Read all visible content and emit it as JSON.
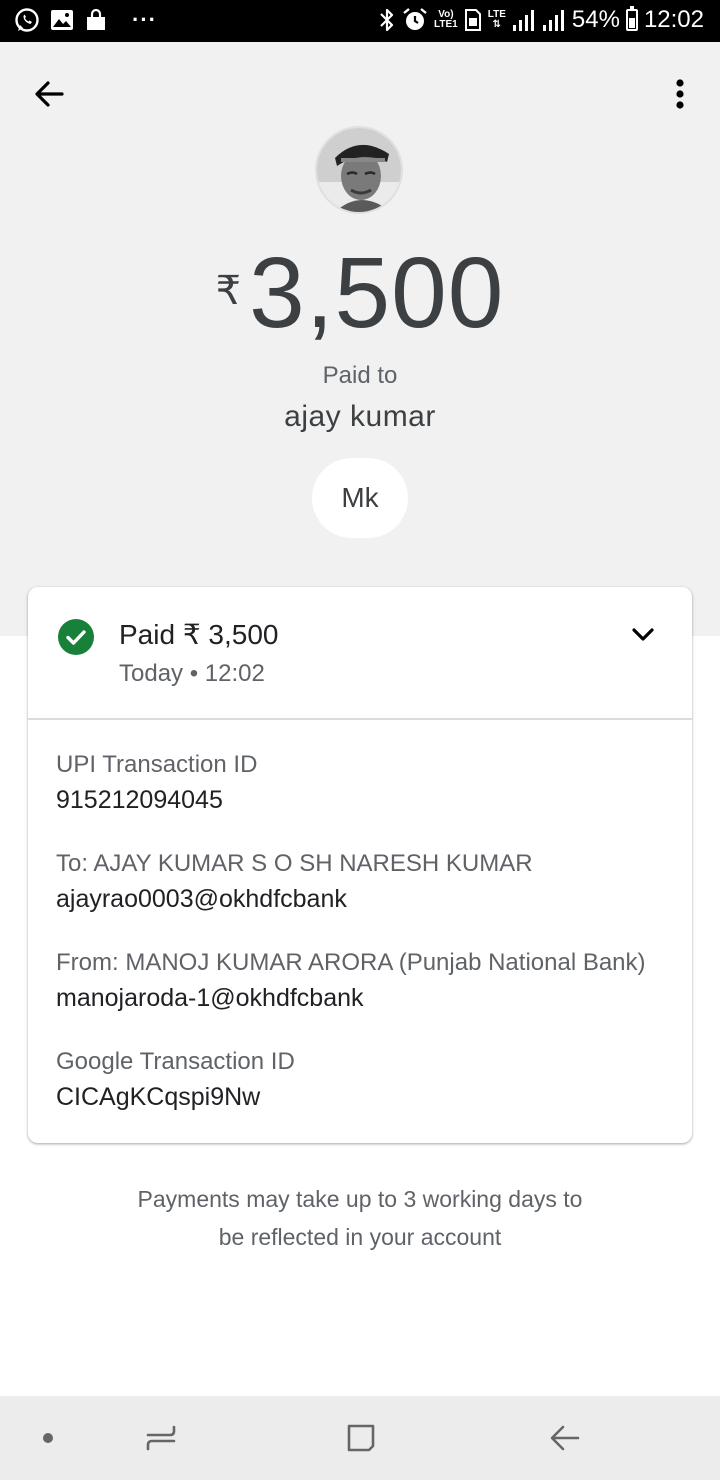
{
  "status_bar": {
    "battery": "54%",
    "time": "12:02",
    "network_top": "Vo)",
    "network_bottom": "LTE1",
    "lte_label": "LTE",
    "dots": "···"
  },
  "payment": {
    "currency_symbol": "₹",
    "amount": "3,500",
    "paid_to_label": "Paid to",
    "payee_name": "ajay kumar",
    "note": "Mk"
  },
  "details_card": {
    "status_title": "Paid ₹ 3,500",
    "status_time": "Today • 12:02",
    "status_color": "#188038",
    "items": [
      {
        "label": "UPI Transaction ID",
        "value": "915212094045"
      },
      {
        "label": "To: AJAY KUMAR S O SH NARESH KUMAR",
        "value": "ajayrao0003@okhdfcbank"
      },
      {
        "label": "From: MANOJ KUMAR ARORA (Punjab National Bank)",
        "value": "manojaroda-1@okhdfcbank"
      },
      {
        "label": "Google Transaction ID",
        "value": "CICAgKCqspi9Nw"
      }
    ]
  },
  "footer": {
    "line1": "Payments may take up to 3 working days to",
    "line2": "be reflected in your account"
  },
  "icons": {
    "back": "arrow-left-icon",
    "more": "more-vert-icon",
    "status": "check-circle-icon",
    "expand": "chevron-down-icon"
  }
}
